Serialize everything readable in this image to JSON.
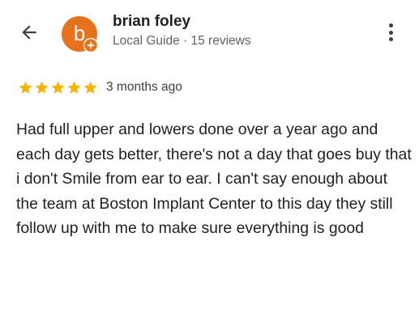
{
  "reviewer": {
    "name": "brian foley",
    "avatar_letter": "b",
    "avatar_color": "#e8711c",
    "badge_icon": "local-guide-star-icon",
    "subtitle": "Local Guide · 15 reviews"
  },
  "header": {
    "back_icon": "arrow-back-icon",
    "more_icon": "more-vert-icon"
  },
  "review": {
    "rating": 5,
    "rating_max": 5,
    "star_color": "#f4b400",
    "date": "3 months ago",
    "text": "Had full upper and lowers done over a year ago and each day gets better, there's not a day that goes buy that i don't Smile from ear to ear. I can't say enough about the team at Boston Implant Center to this day they still follow up with me to make sure everything is good"
  }
}
